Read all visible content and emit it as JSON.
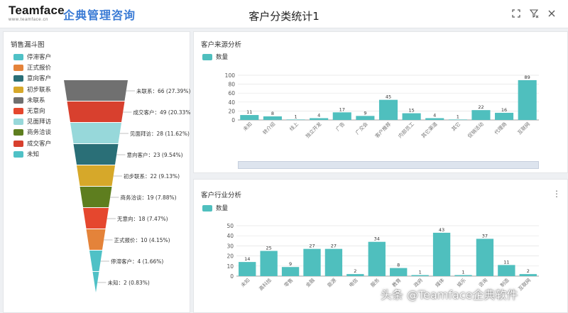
{
  "header": {
    "logo_main": "Teamface",
    "logo_sub": "www.teamface.cn",
    "logo_cn": "企典管理咨询",
    "title": "客户分类统计1",
    "icons": [
      "fullscreen-icon",
      "filter-icon",
      "close-icon"
    ]
  },
  "funnel_panel": {
    "title": "销售漏斗图",
    "legend": [
      {
        "label": "停滞客户",
        "color": "#4fc1c6"
      },
      {
        "label": "正式报价",
        "color": "#e4833a"
      },
      {
        "label": "意向客户",
        "color": "#2a6f77"
      },
      {
        "label": "初步联系",
        "color": "#d6a82a"
      },
      {
        "label": "未联系",
        "color": "#707070"
      },
      {
        "label": "无意向",
        "color": "#e5472e"
      },
      {
        "label": "见面拜访",
        "color": "#97d8da"
      },
      {
        "label": "商务洽谈",
        "color": "#5e7e1f"
      },
      {
        "label": "成交客户",
        "color": "#d8402e"
      },
      {
        "label": "未知",
        "color": "#4fc1c6"
      }
    ]
  },
  "source_panel": {
    "title": "客户来源分析",
    "legend_label": "数量",
    "color": "#4fbfbe"
  },
  "industry_panel": {
    "title": "客户行业分析",
    "legend_label": "数量",
    "color": "#4fbfbe"
  },
  "watermark": "头条 @Teamface企典软件",
  "chart_data": [
    {
      "type": "funnel",
      "title": "销售漏斗图",
      "stages": [
        {
          "name": "未联系",
          "value": 66,
          "label": "未联系：66 (27.39%)",
          "color": "#707070"
        },
        {
          "name": "成交客户",
          "value": 49,
          "label": "成交客户：49 (20.33%)",
          "color": "#d8402e"
        },
        {
          "name": "见面拜访",
          "value": 28,
          "label": "见面拜访：28 (11.62%)",
          "color": "#97d8da"
        },
        {
          "name": "意向客户",
          "value": 23,
          "label": "意向客户：23 (9.54%)",
          "color": "#2a6f77"
        },
        {
          "name": "初步联系",
          "value": 22,
          "label": "初步联系：22 (9.13%)",
          "color": "#d6a82a"
        },
        {
          "name": "商务洽谈",
          "value": 19,
          "label": "商务洽谈：19 (7.88%)",
          "color": "#5e7e1f"
        },
        {
          "name": "无意向",
          "value": 18,
          "label": "无意向：18 (7.47%)",
          "color": "#e5472e"
        },
        {
          "name": "正式报价",
          "value": 10,
          "label": "正式报价：10 (4.15%)",
          "color": "#e4833a"
        },
        {
          "name": "停滞客户",
          "value": 4,
          "label": "停滞客户：4 (1.66%)",
          "color": "#4fc1c6"
        },
        {
          "name": "未知",
          "value": 2,
          "label": "未知：2 (0.83%)",
          "color": "#4fc1c6"
        }
      ]
    },
    {
      "type": "bar",
      "title": "客户来源分析",
      "categories": [
        "未知",
        "转介绍",
        "线上",
        "独立开发",
        "广告",
        "广交会",
        "客户推荐",
        "内部员工",
        "其它渠道",
        "其它",
        "促销活动",
        "代理商",
        "互联网"
      ],
      "series": [
        {
          "name": "数量",
          "values": [
            11,
            8,
            1,
            4,
            17,
            9,
            45,
            15,
            4,
            1,
            22,
            16,
            89
          ]
        }
      ],
      "ylim": [
        0,
        100
      ],
      "yticks": [
        0,
        20,
        40,
        60,
        80,
        100
      ],
      "grid": true
    },
    {
      "type": "bar",
      "title": "客户行业分析",
      "categories": [
        "未知",
        "高科技",
        "零售",
        "金融",
        "能源",
        "电信",
        "服务",
        "教育",
        "政府",
        "媒体",
        "娱乐",
        "咨询",
        "制造",
        "互联网"
      ],
      "series": [
        {
          "name": "数量",
          "values": [
            14,
            25,
            9,
            27,
            27,
            2,
            34,
            8,
            1,
            43,
            1,
            37,
            11,
            2
          ]
        }
      ],
      "ylim": [
        0,
        50
      ],
      "yticks": [
        0,
        10,
        20,
        30,
        40,
        50
      ],
      "grid": true
    }
  ]
}
